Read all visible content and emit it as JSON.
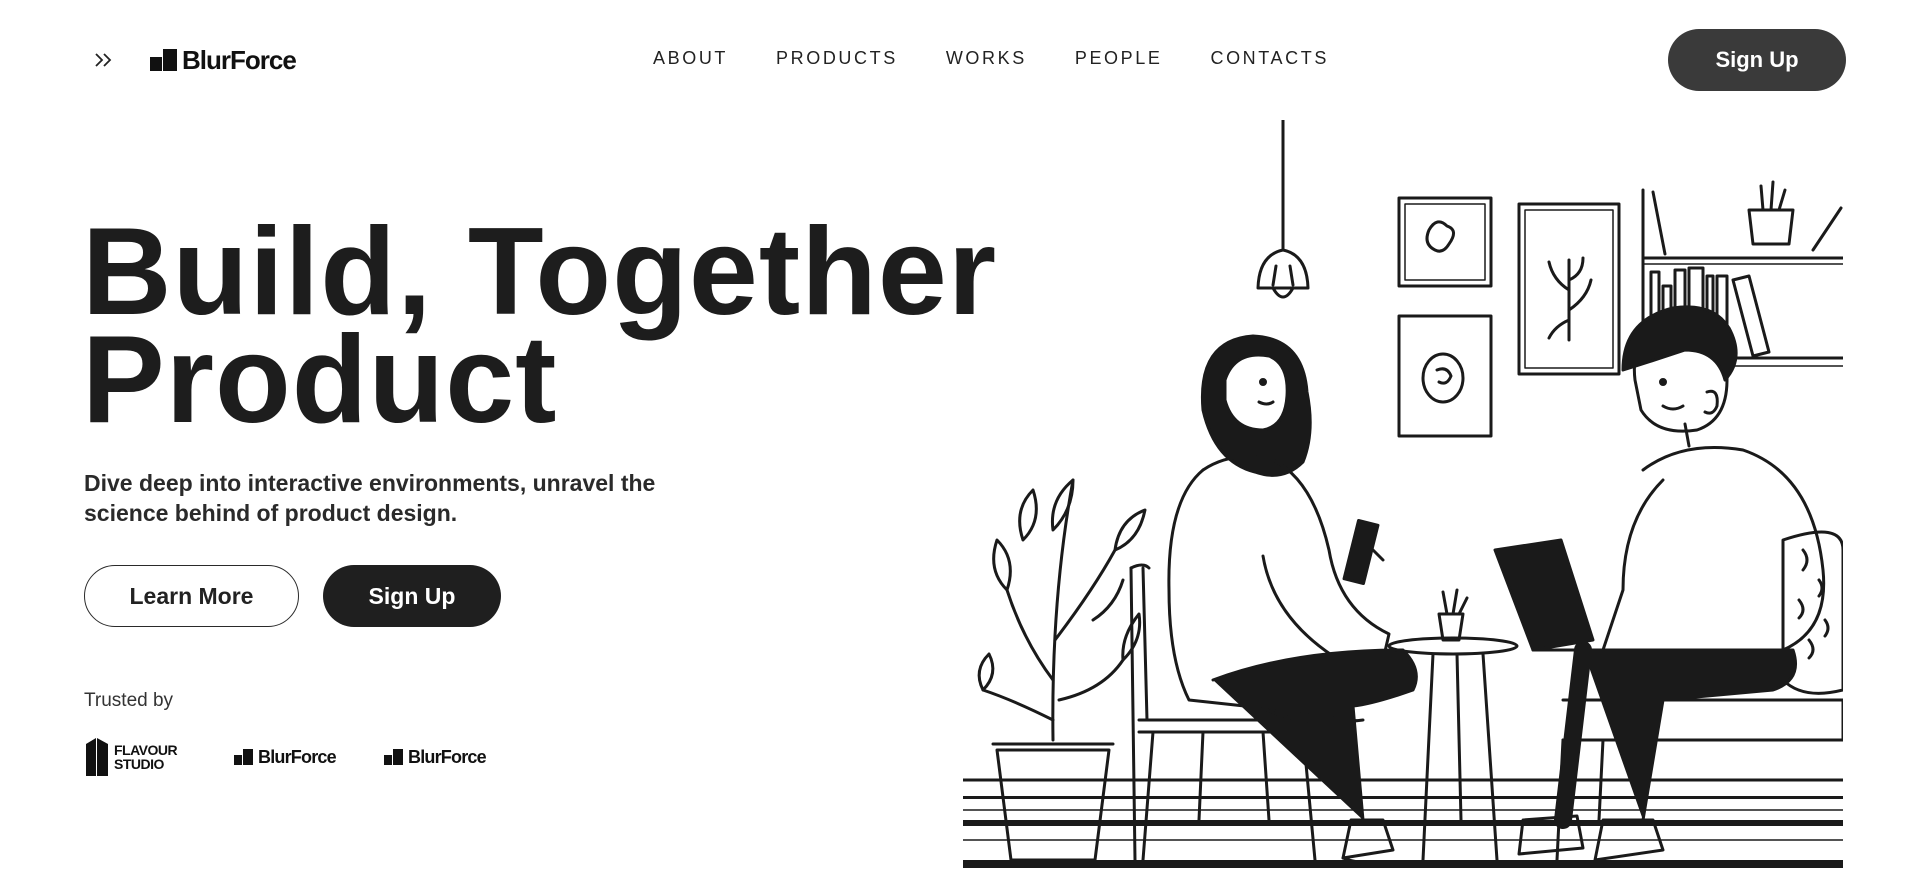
{
  "header": {
    "logo_text": "BlurForce",
    "nav": [
      "ABOUT",
      "PRODUCTS",
      "WORKS",
      "PEOPLE",
      "CONTACTS"
    ],
    "signup_label": "Sign Up"
  },
  "hero": {
    "title_line1": "Build, Together",
    "title_line2": "Product",
    "subtitle": "Dive deep into interactive environments, unravel the science behind of product design.",
    "learn_more_label": "Learn More",
    "signup_label": "Sign Up"
  },
  "trusted": {
    "label": "Trusted by",
    "partners": [
      {
        "name_line1": "FLAVOUR",
        "name_line2": "STUDIO"
      },
      {
        "name": "BlurForce"
      },
      {
        "name": "BlurForce"
      }
    ]
  },
  "icons": {
    "menu": "double-chevron-right-icon",
    "logo": "blurforce-logo-mark"
  },
  "colors": {
    "dark_button": "#3a3a3a",
    "hero_button": "#1f1f1f",
    "text": "#1c1c1c",
    "background": "#ffffff"
  }
}
